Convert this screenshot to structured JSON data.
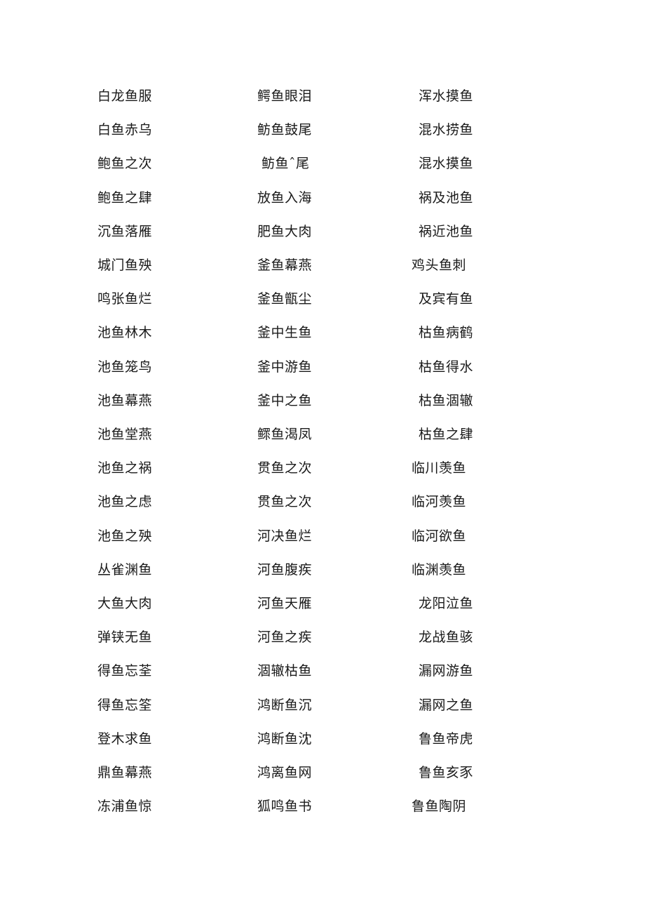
{
  "document": {
    "rows": [
      [
        "白龙鱼服",
        "鳄鱼眼泪",
        "浑水摸鱼"
      ],
      [
        "白鱼赤乌",
        "鲂鱼鼓尾",
        "混水捞鱼"
      ],
      [
        "鲍鱼之次",
        "鲂鱼ˆ尾",
        "混水摸鱼"
      ],
      [
        "鲍鱼之肆",
        "放鱼入海",
        "祸及池鱼"
      ],
      [
        "沉鱼落雁",
        "肥鱼大肉",
        "祸近池鱼"
      ],
      [
        "城门鱼殃",
        "釜鱼幕燕",
        "鸡头鱼刺"
      ],
      [
        "鸣张鱼烂",
        "釜鱼甑尘",
        "及宾有鱼"
      ],
      [
        "池鱼林木",
        "釜中生鱼",
        "枯鱼病鹤"
      ],
      [
        "池鱼笼鸟",
        "釜中游鱼",
        "枯鱼得水"
      ],
      [
        "池鱼幕燕",
        "釜中之鱼",
        "枯鱼涸辙"
      ],
      [
        "池鱼堂燕",
        "鳏鱼渴凤",
        "枯鱼之肆"
      ],
      [
        "池鱼之祸",
        "贯鱼之次",
        "临川羡鱼"
      ],
      [
        "池鱼之虑",
        "贯鱼之次",
        "临河羡鱼"
      ],
      [
        "池鱼之殃",
        "河决鱼烂",
        "临河欲鱼"
      ],
      [
        "丛雀渊鱼",
        "河鱼腹疾",
        "临渊羡鱼"
      ],
      [
        "大鱼大肉",
        "河鱼天雁",
        "龙阳泣鱼"
      ],
      [
        "弹铗无鱼",
        "河鱼之疾",
        "龙战鱼骇"
      ],
      [
        "得鱼忘荃",
        "涸辙枯鱼",
        "漏网游鱼"
      ],
      [
        "得鱼忘筌",
        "鸿断鱼沉",
        "漏网之鱼"
      ],
      [
        "登木求鱼",
        "鸿断鱼沈",
        "鲁鱼帝虎"
      ],
      [
        "鼎鱼幕燕",
        "鸿离鱼网",
        "鲁鱼亥豕"
      ],
      [
        "冻浦鱼惊",
        "狐鸣鱼书",
        "鲁鱼陶阴"
      ]
    ]
  }
}
